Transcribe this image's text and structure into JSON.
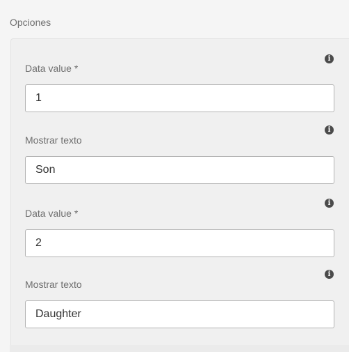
{
  "section": {
    "title": "Opciones"
  },
  "options": [
    {
      "value_label": "Data value *",
      "value": "1",
      "text_label": "Mostrar texto",
      "text": "Son"
    },
    {
      "value_label": "Data value *",
      "value": "2",
      "text_label": "Mostrar texto",
      "text": "Daughter"
    }
  ],
  "icons": {
    "info": "info-icon",
    "info_glyph": "i"
  },
  "colors": {
    "background": "#f5f5f5",
    "panel": "#f0f0f0",
    "field_border": "#b3b3b3",
    "label": "#6e6e6e",
    "icon": "#4b4b4b"
  }
}
